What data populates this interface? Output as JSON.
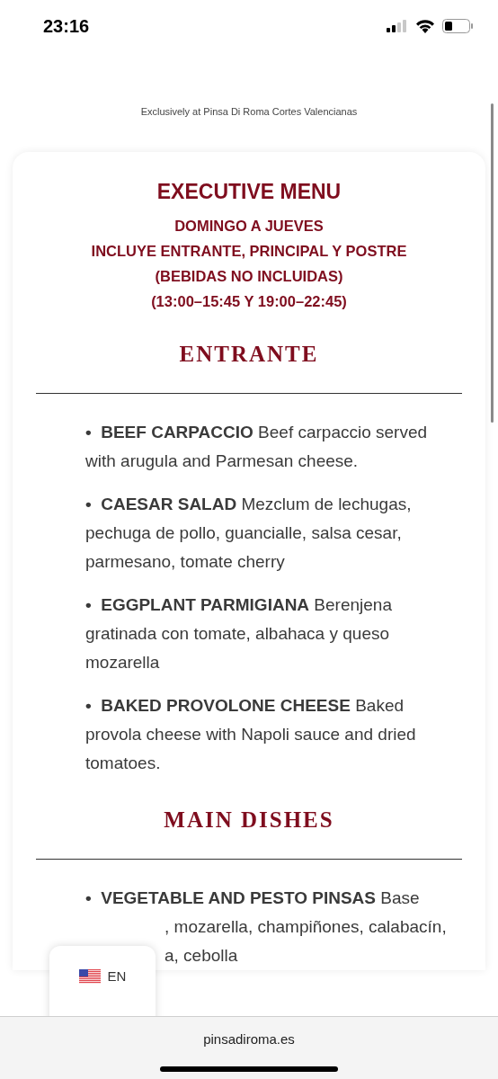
{
  "status_bar": {
    "time": "23:16"
  },
  "tagline": "Exclusively at Pinsa Di Roma Cortes Valencianas",
  "menu": {
    "title": "EXECUTIVE MENU",
    "subtitle_lines": [
      "DOMINGO A JUEVES",
      "INCLUYE ENTRANTE, PRINCIPAL Y POSTRE",
      "(BEBIDAS NO INCLUIDAS)",
      "(13:00–15:45 Y 19:00–22:45)"
    ],
    "sections": [
      {
        "heading": "ENTRANTE",
        "items": [
          {
            "text": "**•  BEEF CARPACCIO** Beef carpaccio served with arugula and Parmesan cheese."
          },
          {
            "text": "**•  CAESAR SALAD** Mezclum de lechugas, pechuga de pollo, guancialle, salsa cesar, parmesano, tomate cherry"
          },
          {
            "text": "**•  EGGPLANT PARMIGIANA** Berenjena gratinada con tomate, albahaca y queso mozarella"
          },
          {
            "text": "**•  BAKED PROVOLONE CHEESE** Baked provola cheese with Napoli sauce and dried tomatoes."
          }
        ]
      },
      {
        "heading": "MAIN DISHES",
        "items": [
          {
            "text": "**•  VEGETABLE AND PESTO PINSAS** Base",
            "covered_lines": [
              ", mozarella, champiñones, calabacín,",
              "a, cebolla"
            ]
          }
        ]
      }
    ]
  },
  "language_widget": {
    "label": "EN"
  },
  "browser_bar": {
    "url": "pinsadiroma.es"
  }
}
